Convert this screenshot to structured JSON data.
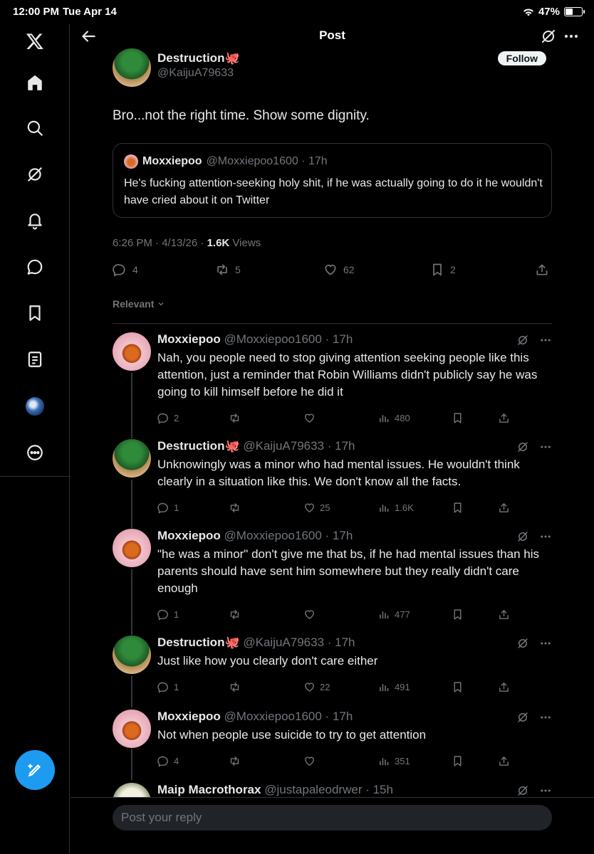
{
  "status_bar": {
    "time": "12:00 PM",
    "date": "Tue Apr 14",
    "battery": "47%",
    "battery_level": 0.47
  },
  "header": {
    "title": "Post"
  },
  "nav": [
    "x-logo-icon",
    "home-icon",
    "search-icon",
    "grok-icon",
    "notifications-icon",
    "messages-icon",
    "bookmarks-icon",
    "lists-icon",
    "profile-avatar",
    "more-icon"
  ],
  "post": {
    "author_name": "Destruction🐙",
    "author_handle": "@KaijuA79633",
    "follow_label": "Follow",
    "text": "Bro...not the right time. Show some dignity.",
    "quote": {
      "name": "Moxxiepoo",
      "handle": "@Moxxiepoo1600 · 17h",
      "text": "He's fucking attention-seeking holy shit, if he was actually going to do it he wouldn't have cried about it on Twitter"
    },
    "time": "6:26 PM · 4/13/26 · ",
    "views_count": "1.6K",
    "views_label": " Views",
    "replies": "4",
    "reposts": "5",
    "likes": "62",
    "bookmarks": "2"
  },
  "sort_label": "Relevant",
  "replies": [
    {
      "name": "Moxxiepoo",
      "handle": "@Moxxiepoo1600 · 17h",
      "text": "Nah, you people need to stop giving attention seeking people like this attention, just a reminder that Robin Williams didn't publicly say he was going to kill himself before he did it",
      "replies": "2",
      "reposts": "",
      "likes": "",
      "views": "480"
    },
    {
      "name": "Destruction🐙",
      "handle": "@KaijuA79633 · 17h",
      "text": "Unknowingly was a minor who had mental issues. He wouldn't think clearly in a situation like this. We don't know all the facts.",
      "replies": "1",
      "reposts": "",
      "likes": "25",
      "views": "1.6K"
    },
    {
      "name": "Moxxiepoo",
      "handle": "@Moxxiepoo1600 · 17h",
      "text": "\"he was a minor\" don't give me that bs, if he had mental issues than his parents should have sent him somewhere but they really didn't care enough",
      "replies": "1",
      "reposts": "",
      "likes": "",
      "views": "477"
    },
    {
      "name": "Destruction🐙",
      "handle": "@KaijuA79633 · 17h",
      "text": "Just like how you clearly don't care either",
      "replies": "1",
      "reposts": "",
      "likes": "22",
      "views": "491"
    },
    {
      "name": "Moxxiepoo",
      "handle": "@Moxxiepoo1600 · 17h",
      "text": "Not when people use suicide to try to get attention",
      "replies": "4",
      "reposts": "",
      "likes": "",
      "views": "351"
    },
    {
      "name": "Maip Macrothorax",
      "handle": "@justapaleodrwer · 15h",
      "text": "",
      "replies": "",
      "reposts": "",
      "likes": "",
      "views": ""
    }
  ],
  "reply_bar": {
    "placeholder": "Post your reply"
  },
  "colors": {
    "background": "#000000",
    "text": "#e7e9ea",
    "muted": "#71767b",
    "accent": "#1d9bf0",
    "border": "#2f3336"
  }
}
